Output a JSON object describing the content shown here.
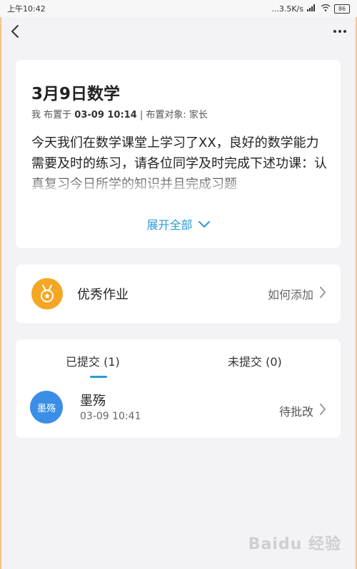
{
  "status_bar": {
    "time": "上午10:42",
    "speed": "...3.5K/s",
    "battery": "86"
  },
  "homework": {
    "title": "3月9日数学",
    "meta_prefix": "我 布置于",
    "meta_datetime": "03-09 10:14",
    "meta_target": " | 布置对象: 家长",
    "body": "今天我们在数学课堂上学习了XX，良好的数学能力需要及时的练习，请各位同学及时完成下述功课：认真复习今日所学的知识并且完成习题",
    "expand_label": "展开全部"
  },
  "excellent": {
    "label": "优秀作业",
    "action": "如何添加"
  },
  "submissions": {
    "tab_submitted": "已提交 (1)",
    "tab_unsubmitted": "未提交 (0)",
    "items": [
      {
        "avatar_text": "墨殇",
        "name": "墨殇",
        "time": "03-09 10:41",
        "status": "待批改"
      }
    ]
  },
  "icons": {
    "back": "back-arrow-icon",
    "more": "more-icon",
    "medal": "medal-icon",
    "chevron_down": "chevron-down-icon",
    "chevron_right": "chevron-right-icon"
  },
  "colors": {
    "accent": "#2b9bd6",
    "medal": "#f5a623",
    "avatar": "#3a8ee6"
  },
  "watermark": "Baidu 经验"
}
